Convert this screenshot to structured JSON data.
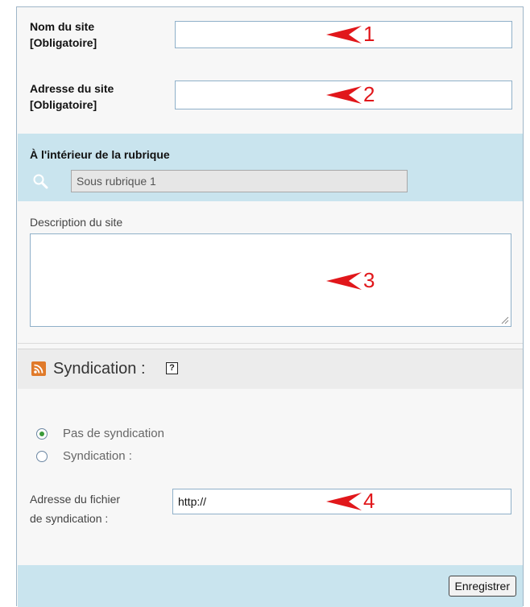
{
  "form": {
    "site_name": {
      "label_line1": "Nom du site",
      "label_line2": "[Obligatoire]",
      "value": ""
    },
    "site_url": {
      "label_line1": "Adresse du site",
      "label_line2": "[Obligatoire]",
      "value": ""
    },
    "rubrique": {
      "label": "À l'intérieur de la rubrique",
      "value": "Sous rubrique 1"
    },
    "description": {
      "label": "Description du site",
      "value": ""
    },
    "syndication": {
      "title": "Syndication :",
      "help_glyph": "?",
      "options": [
        {
          "label": "Pas de syndication",
          "selected": true
        },
        {
          "label": "Syndication :",
          "selected": false
        }
      ],
      "feed_label_line1": "Adresse du fichier",
      "feed_label_line2": "de syndication :",
      "feed_value": "http://"
    },
    "save_label": "Enregistrer"
  },
  "annotations": [
    "1",
    "2",
    "3",
    "4"
  ],
  "colors": {
    "band": "#c9e4ee",
    "border": "#8fb0c9",
    "arrow": "#e1171b",
    "rss": "#e07a2a"
  }
}
